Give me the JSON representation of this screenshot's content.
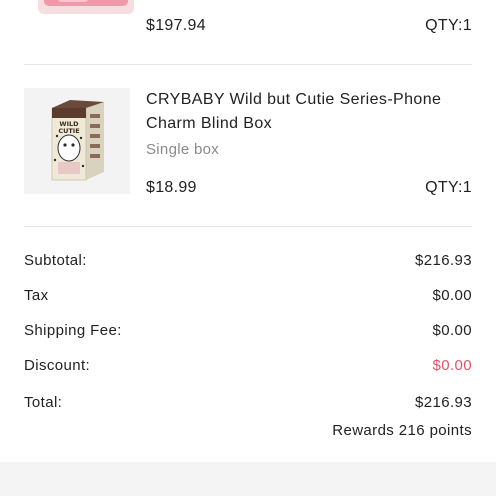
{
  "items": [
    {
      "price": "$197.94",
      "qty": "QTY:1"
    },
    {
      "title": "CRYBABY Wild but Cutie Series-Phone Charm Blind Box",
      "variant": "Single box",
      "price": "$18.99",
      "qty": "QTY:1",
      "box_text": "WILD CUTIE"
    }
  ],
  "summary": {
    "subtotal_label": "Subtotal:",
    "subtotal_value": "$216.93",
    "tax_label": "Tax",
    "tax_value": "$0.00",
    "shipping_label": "Shipping Fee:",
    "shipping_value": "$0.00",
    "discount_label": "Discount:",
    "discount_value": "$0.00",
    "total_label": "Total:",
    "total_value": "$216.93",
    "rewards": "Rewards 216 points"
  },
  "colors": {
    "discount": "#e0536a",
    "muted": "#8a8a8a",
    "divider": "#e6e6e6"
  }
}
